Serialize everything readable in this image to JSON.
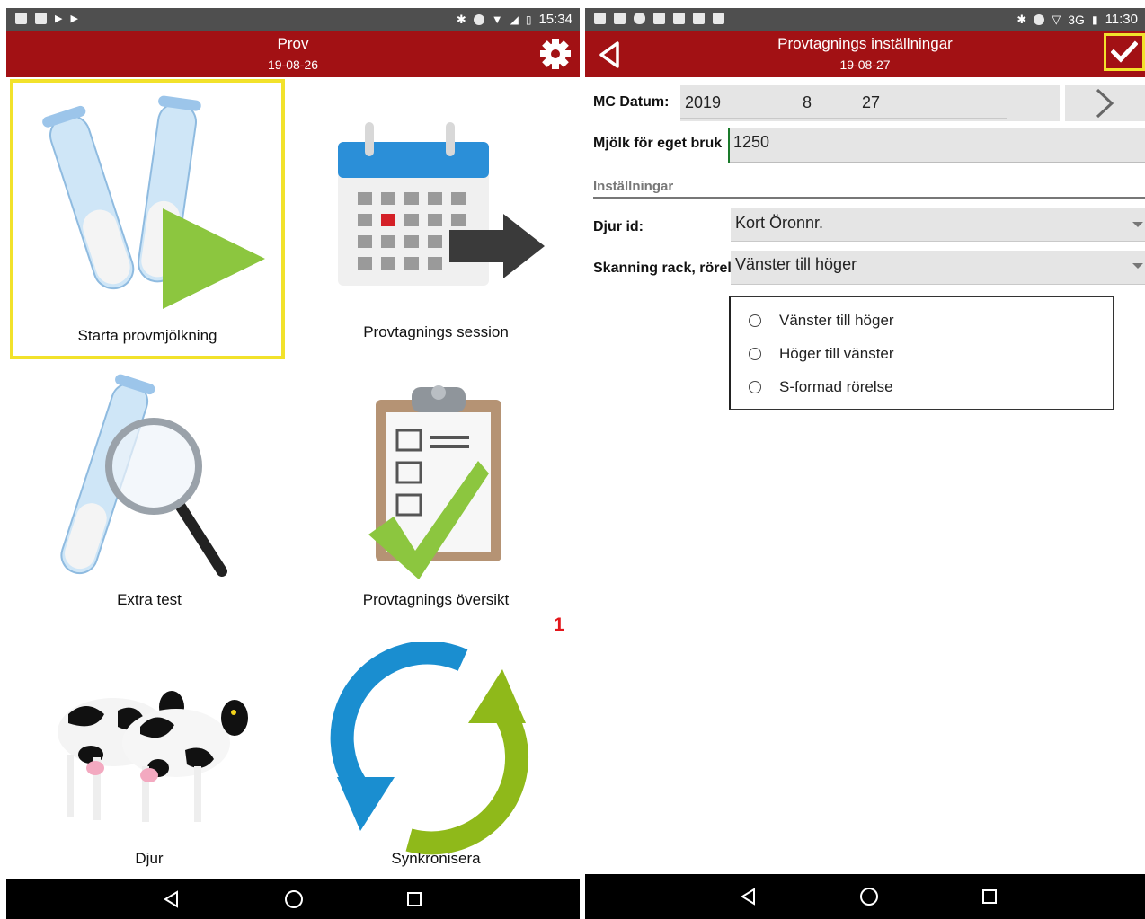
{
  "left_screen": {
    "status": {
      "time": "15:34"
    },
    "header": {
      "title": "Prov",
      "date": "19-08-26"
    },
    "tiles": [
      {
        "label": "Starta provmjölkning"
      },
      {
        "label": "Provtagnings session"
      },
      {
        "label": "Extra test"
      },
      {
        "label": "Provtagnings översikt"
      },
      {
        "label": "Djur"
      },
      {
        "label": "Synkronisera"
      }
    ],
    "sync_badge": "1",
    "icons": [
      "gear-icon",
      "back-icon",
      "home-icon",
      "recents-icon"
    ]
  },
  "right_screen": {
    "status": {
      "network": "3G",
      "time": "11:30"
    },
    "header": {
      "title": "Provtagnings inställningar",
      "date": "19-08-27"
    },
    "mc_datum": {
      "label": "MC Datum:",
      "year": "2019",
      "month": "8",
      "day": "27"
    },
    "mjolk": {
      "label": "Mjölk för eget bruk",
      "value": "1250"
    },
    "section_title": "Inställningar",
    "djur_id": {
      "label": "Djur id:",
      "value": "Kort Öronnr."
    },
    "skanning": {
      "label": "Skanning rack, rörels",
      "value": "Vänster till höger"
    },
    "options": [
      "Vänster till höger",
      "Höger till vänster",
      "S-formad rörelse"
    ]
  },
  "colors": {
    "appbar": "#a21114",
    "highlight": "#f2e22b",
    "statusbar": "#4f4f4f",
    "badge": "#e3161b"
  }
}
